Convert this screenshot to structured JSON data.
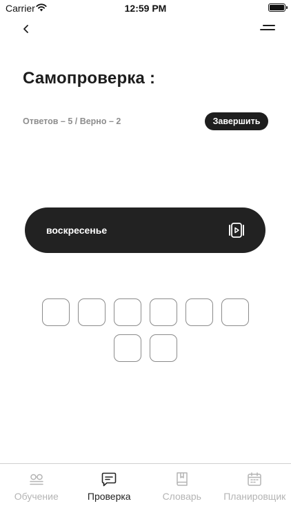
{
  "status_bar": {
    "carrier": "Carrier",
    "time": "12:59 PM"
  },
  "header": {
    "title": "Самопроверка :",
    "stats": "Ответов – 5 / Верно – 2",
    "finish_label": "Завершить"
  },
  "card": {
    "word": "воскресенье",
    "icon": "play-video-icon"
  },
  "letter_slots": {
    "rows": [
      [
        "",
        "",
        "",
        "",
        "",
        ""
      ],
      [
        "",
        ""
      ]
    ]
  },
  "tabs": [
    {
      "label": "Обучение",
      "icon": "glasses-icon",
      "active": false
    },
    {
      "label": "Проверка",
      "icon": "chat-icon",
      "active": true
    },
    {
      "label": "Словарь",
      "icon": "book-icon",
      "active": false
    },
    {
      "label": "Планировщик",
      "icon": "calendar-icon",
      "active": false
    }
  ],
  "colors": {
    "dark": "#222222",
    "muted": "#8d8d8d",
    "tab_inactive": "#b4b4b4",
    "background": "#ffffff"
  }
}
